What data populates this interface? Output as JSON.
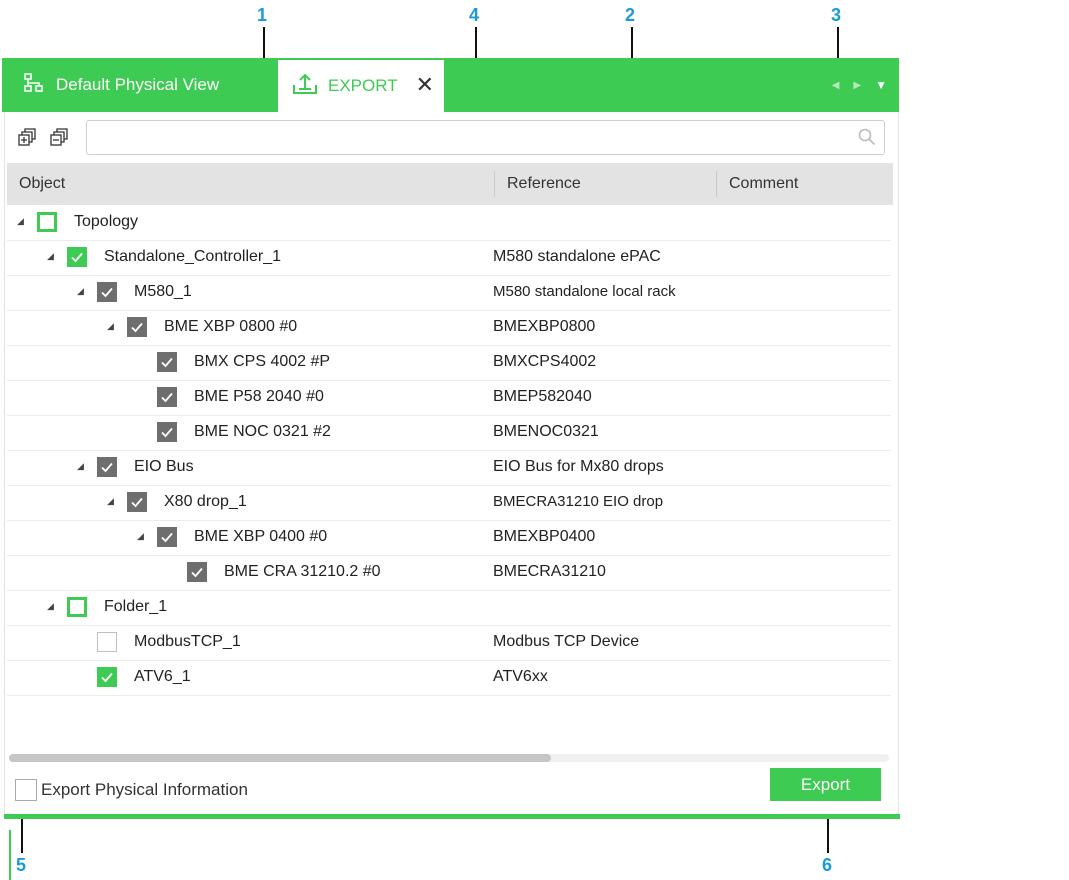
{
  "callouts": [
    "1",
    "4",
    "2",
    "3",
    "5",
    "6"
  ],
  "tabs": {
    "default_label": "Default Physical View",
    "export_label": "EXPORT",
    "close_glyph": "✕"
  },
  "search": {
    "placeholder": "",
    "value": ""
  },
  "columns": {
    "object": "Object",
    "reference": "Reference",
    "comment": "Comment"
  },
  "tree": [
    {
      "indent": 0,
      "expander": true,
      "checkbox": "green-square",
      "name": "Topology",
      "ref": "",
      "arial": false
    },
    {
      "indent": 1,
      "expander": true,
      "checkbox": "green-check",
      "name": "Standalone_Controller_1",
      "ref": "M580 standalone ePAC",
      "arial": false
    },
    {
      "indent": 2,
      "expander": true,
      "checkbox": "gray-check",
      "name": "M580_1",
      "ref": "M580 standalone local rack",
      "arial": true
    },
    {
      "indent": 3,
      "expander": true,
      "checkbox": "gray-check",
      "name": "BME XBP 0800 #0",
      "ref": "BMEXBP0800",
      "arial": false
    },
    {
      "indent": 4,
      "expander": false,
      "checkbox": "gray-check",
      "name": "BMX CPS 4002 #P",
      "ref": "BMXCPS4002",
      "arial": false
    },
    {
      "indent": 4,
      "expander": false,
      "checkbox": "gray-check",
      "name": "BME P58 2040 #0",
      "ref": "BMEP582040",
      "arial": false
    },
    {
      "indent": 4,
      "expander": false,
      "checkbox": "gray-check",
      "name": "BME NOC 0321 #2",
      "ref": "BMENOC0321",
      "arial": false
    },
    {
      "indent": 2,
      "expander": true,
      "checkbox": "gray-check",
      "name": "EIO Bus",
      "ref": "EIO Bus for Mx80 drops",
      "arial": false
    },
    {
      "indent": 3,
      "expander": true,
      "checkbox": "gray-check",
      "name": "X80 drop_1",
      "ref": "BMECRA31210 EIO drop",
      "arial": true
    },
    {
      "indent": 4,
      "expander": true,
      "checkbox": "gray-check",
      "name": "BME XBP 0400 #0",
      "ref": "BMEXBP0400",
      "arial": false
    },
    {
      "indent": 5,
      "expander": false,
      "checkbox": "gray-check",
      "name": "BME CRA 31210.2 #0",
      "ref": "BMECRA31210",
      "arial": false
    },
    {
      "indent": 1,
      "expander": true,
      "checkbox": "green-square",
      "name": "Folder_1",
      "ref": "",
      "arial": false
    },
    {
      "indent": 2,
      "expander": false,
      "checkbox": "empty",
      "name": "ModbusTCP_1",
      "ref": "Modbus TCP Device",
      "arial": false
    },
    {
      "indent": 2,
      "expander": false,
      "checkbox": "green-check",
      "name": "ATV6_1",
      "ref": "ATV6xx",
      "arial": false
    }
  ],
  "footer": {
    "export_physical_label": "Export Physical Information",
    "export_button": "Export"
  },
  "colors": {
    "accent": "#3ecb53",
    "callout": "#1a9bd7"
  }
}
